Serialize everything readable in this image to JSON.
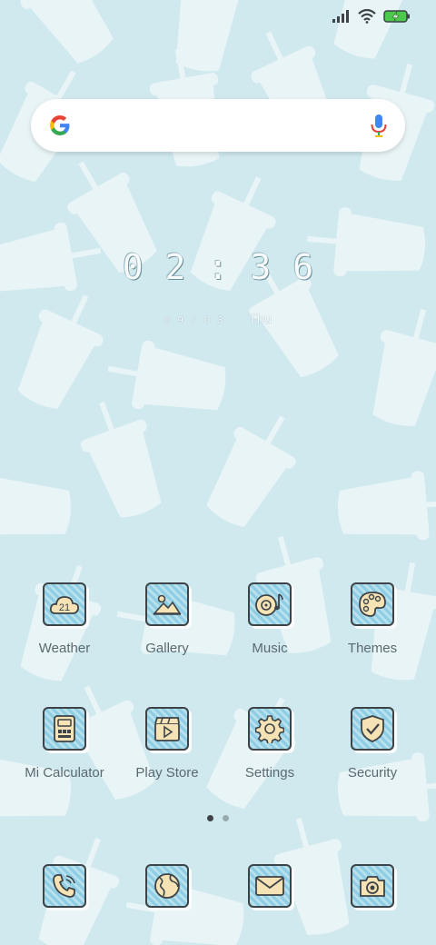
{
  "status_bar": {
    "signal_icon": "signal-icon",
    "wifi_icon": "wifi-icon",
    "battery_icon": "battery-charging-icon"
  },
  "search": {
    "logo": "google-g-icon",
    "mic": "mic-icon"
  },
  "clock": {
    "time": "02:36",
    "date": "09/03",
    "day": "Thu"
  },
  "apps": [
    {
      "label": "Weather",
      "icon": "weather-icon",
      "badge": "21"
    },
    {
      "label": "Gallery",
      "icon": "gallery-icon"
    },
    {
      "label": "Music",
      "icon": "music-icon"
    },
    {
      "label": "Themes",
      "icon": "themes-icon"
    },
    {
      "label": "Mi Calculator",
      "icon": "calculator-icon"
    },
    {
      "label": "Play Store",
      "icon": "play-store-icon"
    },
    {
      "label": "Settings",
      "icon": "settings-icon"
    },
    {
      "label": "Security",
      "icon": "security-icon"
    }
  ],
  "dock": [
    {
      "icon": "phone-icon"
    },
    {
      "icon": "browser-icon"
    },
    {
      "icon": "messages-icon"
    },
    {
      "icon": "camera-icon"
    }
  ],
  "pages": {
    "count": 2,
    "active": 1
  },
  "colors": {
    "background": "#cfe9ee",
    "cup": "#e9f4f7",
    "tile_stripe": "#8ecde3",
    "outline": "#3d4347",
    "label": "#5b6a70"
  }
}
